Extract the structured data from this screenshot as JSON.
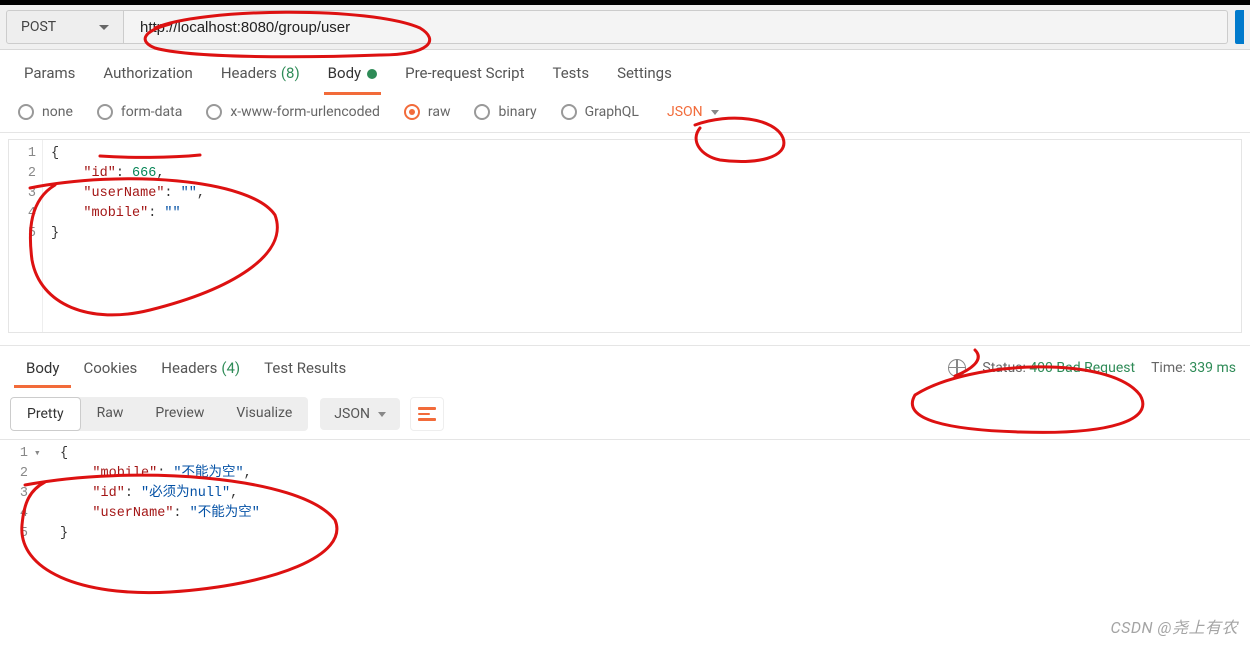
{
  "request": {
    "method": "POST",
    "url": "http://localhost:8080/group/user"
  },
  "tabs": {
    "params": "Params",
    "authorization": "Authorization",
    "headers": "Headers",
    "headers_count": "(8)",
    "body": "Body",
    "pre_request": "Pre-request Script",
    "tests": "Tests",
    "settings": "Settings"
  },
  "body_types": {
    "none": "none",
    "form_data": "form-data",
    "urlencoded": "x-www-form-urlencoded",
    "raw": "raw",
    "binary": "binary",
    "graphql": "GraphQL",
    "raw_type": "JSON"
  },
  "request_body": {
    "lines": [
      "1",
      "2",
      "3",
      "4",
      "5"
    ],
    "json": {
      "id": 666,
      "userName": "",
      "mobile": ""
    }
  },
  "response_tabs": {
    "body": "Body",
    "cookies": "Cookies",
    "headers": "Headers",
    "headers_count": "(4)",
    "test_results": "Test Results"
  },
  "status": {
    "label": "Status:",
    "value": "400 Bad Request",
    "time_label": "Time:",
    "time_value": "339 ms"
  },
  "view": {
    "pretty": "Pretty",
    "raw": "Raw",
    "preview": "Preview",
    "visualize": "Visualize",
    "type": "JSON"
  },
  "response_body": {
    "lines": [
      "1",
      "2",
      "3",
      "4",
      "5"
    ],
    "json": {
      "mobile": "不能为空",
      "id": "必须为null",
      "userName": "不能为空"
    }
  },
  "watermark": "CSDN @尧上有农"
}
